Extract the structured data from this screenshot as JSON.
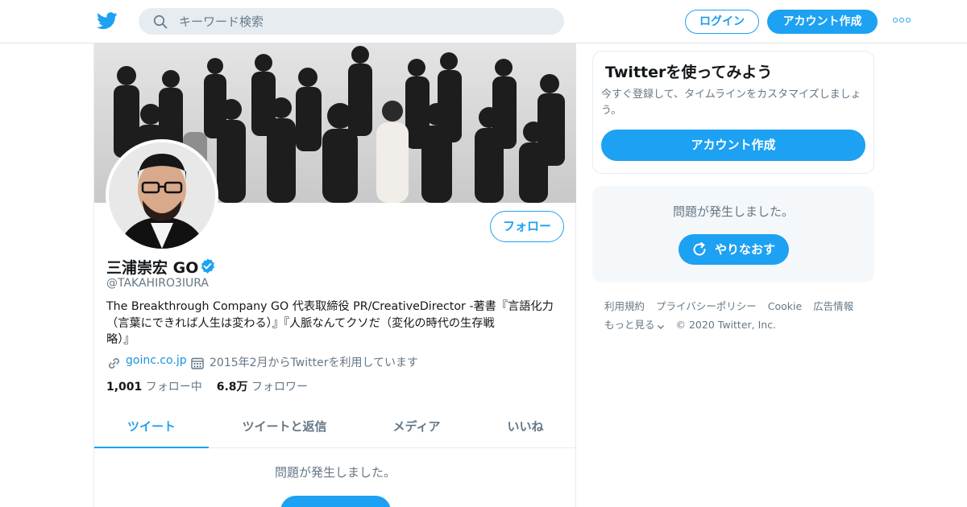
{
  "header": {
    "search_placeholder": "キーワード検索",
    "login_label": "ログイン",
    "signup_label": "アカウント作成",
    "icons": [
      "twitter-bird-icon",
      "search-icon",
      "more-dots-icon"
    ]
  },
  "profile": {
    "name": "三浦崇宏 GO",
    "verified": true,
    "handle": "@TAKAHIRO3IURA",
    "follow_label": "フォロー",
    "bio_lines": [
      "The Breakthrough Company GO 代表取締役 PR/CreativeDirector -著書『言語化力",
      "（言葉にできれば人生は変わる）』『人脈なんてクソだ（変化の時代の生存戦",
      "略）』"
    ],
    "website": "goinc.co.jp",
    "joined": "2015年2月からTwitterを利用しています",
    "following_count": "1,001",
    "following_label": "フォロー中",
    "followers_count": "6.8万",
    "followers_label": "フォロワー"
  },
  "tabs": [
    {
      "label": "ツイート",
      "active": true
    },
    {
      "label": "ツイートと返信",
      "active": false
    },
    {
      "label": "メディア",
      "active": false
    },
    {
      "label": "いいね",
      "active": false
    }
  ],
  "timeline": {
    "error_message": "問題が発生しました。"
  },
  "sidebar": {
    "signup_card": {
      "title": "Twitterを使ってみよう",
      "description": "今すぐ登録して、タイムラインをカスタマイズしましょう。",
      "button_label": "アカウント作成"
    },
    "error_card": {
      "message": "問題が発生しました。",
      "retry_label": "やりなおす"
    },
    "footer": {
      "links": [
        "利用規約",
        "プライバシーポリシー",
        "Cookie",
        "広告情報"
      ],
      "more_label": "もっと見る",
      "copyright": "© 2020 Twitter, Inc."
    }
  },
  "colors": {
    "accent": "#1da1f2",
    "text_primary": "#14171a",
    "text_secondary": "#657786",
    "search_bg": "#e6ecf0",
    "card_bg": "#f5f8fa"
  }
}
